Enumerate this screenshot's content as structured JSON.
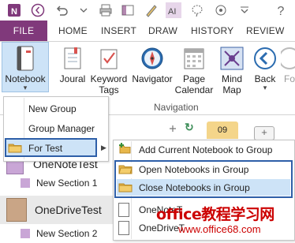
{
  "tabs": {
    "file": "FILE",
    "items": [
      "HOME",
      "INSERT",
      "DRAW",
      "HISTORY",
      "REVIEW"
    ]
  },
  "ribbon": {
    "notebook": "Notebook",
    "journal": "Joural",
    "keyword_tags": [
      "Keyword",
      "Tags"
    ],
    "navigator": "Navigator",
    "page_calendar": [
      "Page",
      "Calendar"
    ],
    "mind_map": [
      "Mind",
      "Map"
    ],
    "back": "Back",
    "cut_label": "Fo",
    "group_label": "Navigation"
  },
  "menu": {
    "items": [
      "New Group",
      "Group Manager",
      "For Test"
    ]
  },
  "submenu": {
    "items": [
      "Add Current Notebook to Group",
      "Open Notebooks in Group",
      "Close Notebooks in Group"
    ]
  },
  "pane": {
    "notebooks": [
      "OneNoteTest",
      "OneDriveTest"
    ],
    "sections": [
      "New Section 1",
      "New Section 2"
    ],
    "behind_submenu": [
      "OneNoteT",
      "OneDriveT"
    ],
    "page_tab": "09"
  },
  "watermark": {
    "line1": "office教程学习网",
    "line2": "www.office68.com"
  },
  "colors": {
    "file_tab": "#80397b",
    "highlight": "#cde3f7",
    "highlight_border": "#2e5fa8",
    "section_purple": "#c9a6d6",
    "watermark": "#cc0000"
  }
}
